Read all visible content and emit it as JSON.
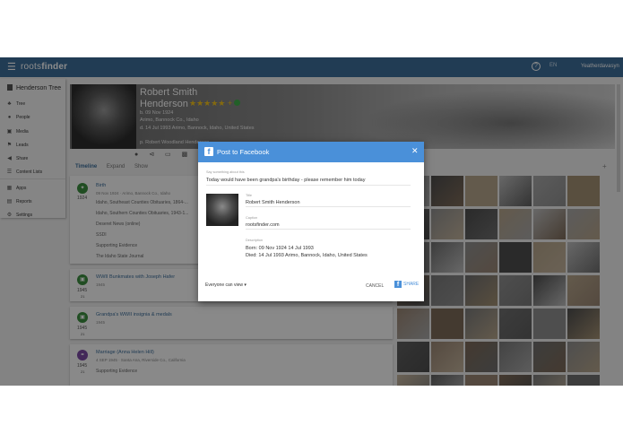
{
  "topbar": {
    "menu_icon": "hamburger-icon",
    "logo_light": "roots",
    "logo_bold": "finder",
    "help_icon": "help-icon",
    "lang": "EN",
    "user": "Yeatherdavasyn"
  },
  "sidebar": {
    "title": "Henderson Tree",
    "items": [
      {
        "label": "Tree",
        "icon": "tree-icon"
      },
      {
        "label": "People",
        "icon": "person-icon"
      },
      {
        "label": "Media",
        "icon": "image-icon"
      },
      {
        "label": "Leads",
        "icon": "lead-icon"
      },
      {
        "label": "Share",
        "icon": "share-icon"
      },
      {
        "label": "Content Lists",
        "icon": "list-icon"
      },
      {
        "label": "Apps",
        "icon": "apps-icon"
      },
      {
        "label": "Reports",
        "icon": "report-icon"
      },
      {
        "label": "Settings",
        "icon": "gear-icon"
      }
    ]
  },
  "person": {
    "first": "Robert Smith",
    "last": "Henderson",
    "birth": "b. 09 Nov 1924",
    "birth_place": "Arimo, Bannock Co., Idaho",
    "death": "d. 14 Jul 1993   Arimo, Bannock, Idaho, United States",
    "parent": "p. Robert Woodland Henderson"
  },
  "tabs": [
    "Timeline",
    "Expand",
    "Show"
  ],
  "timeline": [
    {
      "year": "1924",
      "title": "Birth",
      "detail": "09 Nov 1924 · Arimo, Bannock Co., Idaho",
      "lines": [
        "Idaho, Southeast Counties Obituaries, 1864-...",
        "Idaho, Southern Counties Obituaries, 1943-1...",
        "Deseret News (online)",
        "SSDI",
        "Supporting Evidence",
        "The Idaho State Journal"
      ]
    },
    {
      "year": "1945",
      "sub": "21",
      "title": "WWII Bunkmates with Joseph Hafer",
      "detail": "1945"
    },
    {
      "year": "1945",
      "sub": "21",
      "title": "Grandpa's WWII insignia & medals",
      "detail": "1945"
    },
    {
      "year": "1945",
      "sub": "21",
      "title": "Marriage (Anna Helen Hill)",
      "detail": "4 SEP 1945 · Santa Ana, Riverside Co., California",
      "lines": [
        "Supporting Evidence"
      ]
    }
  ],
  "dialog": {
    "title": "Post to Facebook",
    "msg_label": "Say something about this",
    "message": "Today would have been grandpa's birthday - please remember him today",
    "title_label": "Title",
    "title_value": "Robert Smith Henderson",
    "caption_label": "Caption",
    "caption_value": "rootsfinder.com",
    "desc_label": "Description",
    "desc_line1": "Born: 09 Nov 1924 14 Jul 1993",
    "desc_line2": "Died: 14 Jul 1993 Arimo, Bannock, Idaho, United States",
    "audience": "Everyone can view",
    "cancel": "CANCEL",
    "share": "SHARE"
  },
  "colors": {
    "brand": "#3c6d99",
    "facebook": "#4a90d9",
    "event_green": "#3b8d3e",
    "event_purple": "#7a4aa2",
    "star": "#f3c21b"
  }
}
